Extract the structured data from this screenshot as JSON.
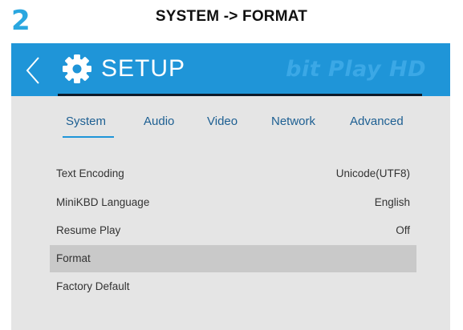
{
  "step": "2",
  "heading": "SYSTEM -> FORMAT",
  "header": {
    "title": "SETUP",
    "brand": "bit Play HD",
    "back_icon": "chevron-left-icon",
    "settings_icon": "gear-icon"
  },
  "tabs": [
    {
      "label": "System",
      "active": true
    },
    {
      "label": "Audio"
    },
    {
      "label": "Video"
    },
    {
      "label": "Network"
    },
    {
      "label": "Advanced"
    }
  ],
  "settings": [
    {
      "label": "Text Encoding",
      "value": "Unicode(UTF8)"
    },
    {
      "label": "MiniKBD Language",
      "value": "English"
    },
    {
      "label": "Resume Play",
      "value": "Off"
    },
    {
      "label": "Format",
      "value": "",
      "selected": true
    },
    {
      "label": "Factory Default",
      "value": ""
    }
  ],
  "colors": {
    "accent": "#1f95d8",
    "step_number": "#2aa7e0",
    "panel_background": "#e5e5e5",
    "selected_row": "#c9c9c9",
    "tab_text": "#1d5f92"
  }
}
